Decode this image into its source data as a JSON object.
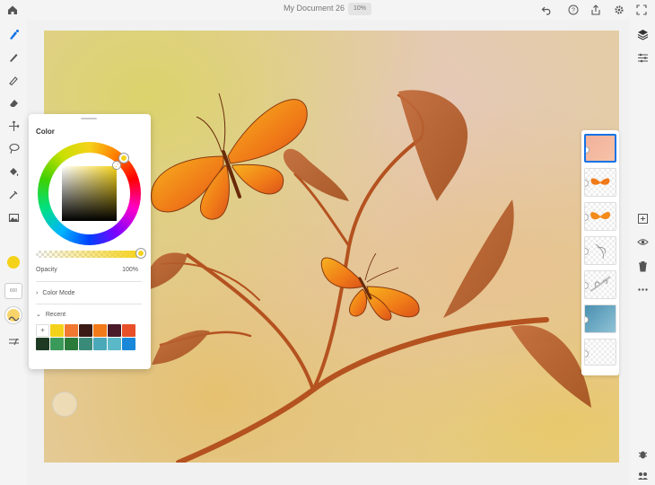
{
  "header": {
    "document_title": "My Document 26",
    "zoom": "10%",
    "icons": [
      "home-icon",
      "undo-icon",
      "help-icon",
      "share-icon",
      "settings-icon",
      "fullscreen-icon"
    ]
  },
  "left_tools": [
    "pixel-brush-icon",
    "live-brush-icon",
    "vector-brush-icon",
    "eraser-icon",
    "transform-icon",
    "lasso-icon",
    "fill-icon",
    "eyedropper-icon",
    "image-icon"
  ],
  "brush_size": "600",
  "color_panel": {
    "title": "Color",
    "current_color": "#f5d21a",
    "opacity_label": "Opacity",
    "opacity_value": "100%",
    "opacity_fraction": 1.0,
    "color_mode_label": "Color Mode",
    "recent_label": "Recent",
    "add_label": "+",
    "recent_swatches": [
      "#f5d21a",
      "#f07830",
      "#3a1a14",
      "#f27a18",
      "#4a1a2a",
      "#e8502a",
      "#1e3a22",
      "#3a9a5a",
      "#2a7a3a",
      "#3a8a7a",
      "#4aa8b8",
      "#5ab8c8",
      "#1a88d8"
    ]
  },
  "right_tools": [
    "layers-icon",
    "properties-icon",
    "add-layer-icon",
    "visibility-icon",
    "delete-layer-icon",
    "more-icon"
  ],
  "layers_count": 7
}
